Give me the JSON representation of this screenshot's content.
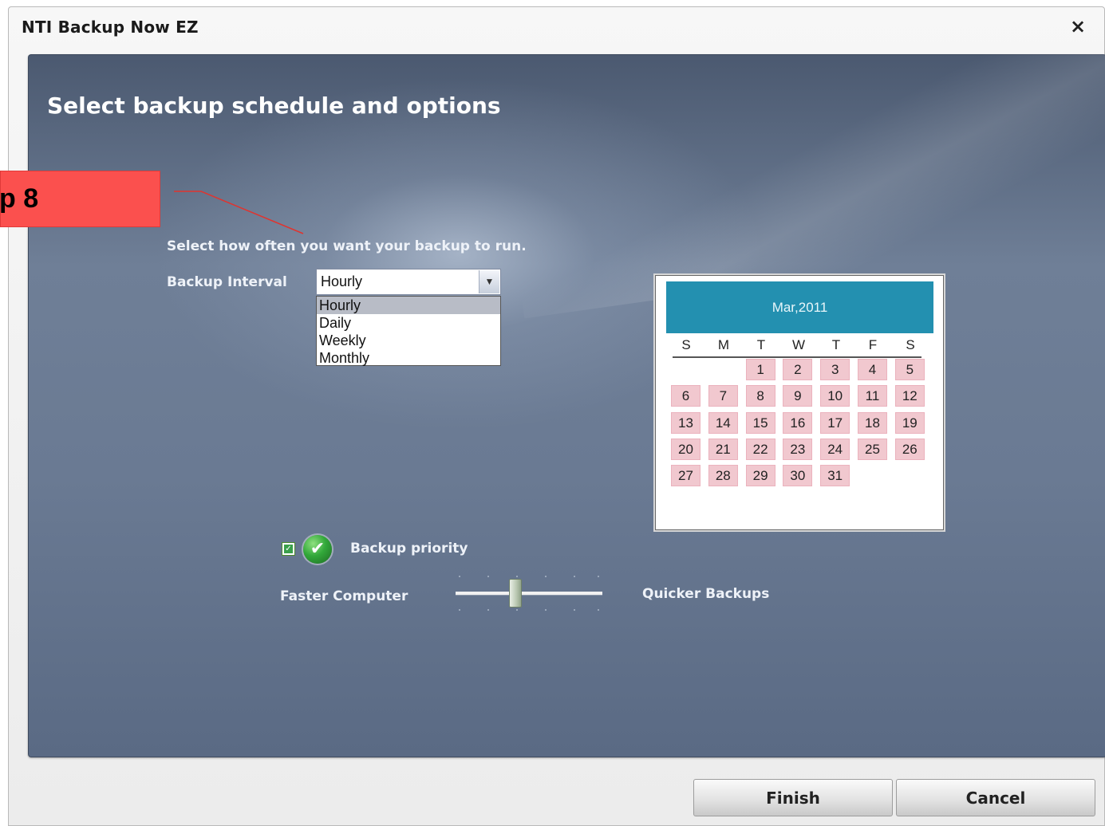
{
  "window": {
    "title": "NTI Backup Now EZ",
    "close_glyph": "×"
  },
  "page": {
    "heading": "Select backup schedule and options",
    "prompt": "Select how often you want your backup to run."
  },
  "interval": {
    "label": "Backup Interval",
    "selected": "Hourly",
    "arrow_glyph": "▼",
    "options": [
      "Hourly",
      "Daily",
      "Weekly",
      "Monthly"
    ]
  },
  "calendar": {
    "month_label": "Mar,2011",
    "weekdays": [
      "S",
      "M",
      "T",
      "W",
      "T",
      "F",
      "S"
    ],
    "first_weekday_index": 2,
    "days_in_month": 31,
    "highlight_color": "#f1c8cf",
    "header_color": "#2390b0"
  },
  "priority": {
    "label": "Backup priority",
    "checked": true,
    "check_glyph": "✔",
    "left_label": "Faster Computer",
    "right_label": "Quicker Backups",
    "slider_position": 0.4
  },
  "buttons": {
    "finish": "Finish",
    "cancel": "Cancel"
  },
  "annotation": {
    "text": "p 8",
    "color": "#fb504e"
  }
}
